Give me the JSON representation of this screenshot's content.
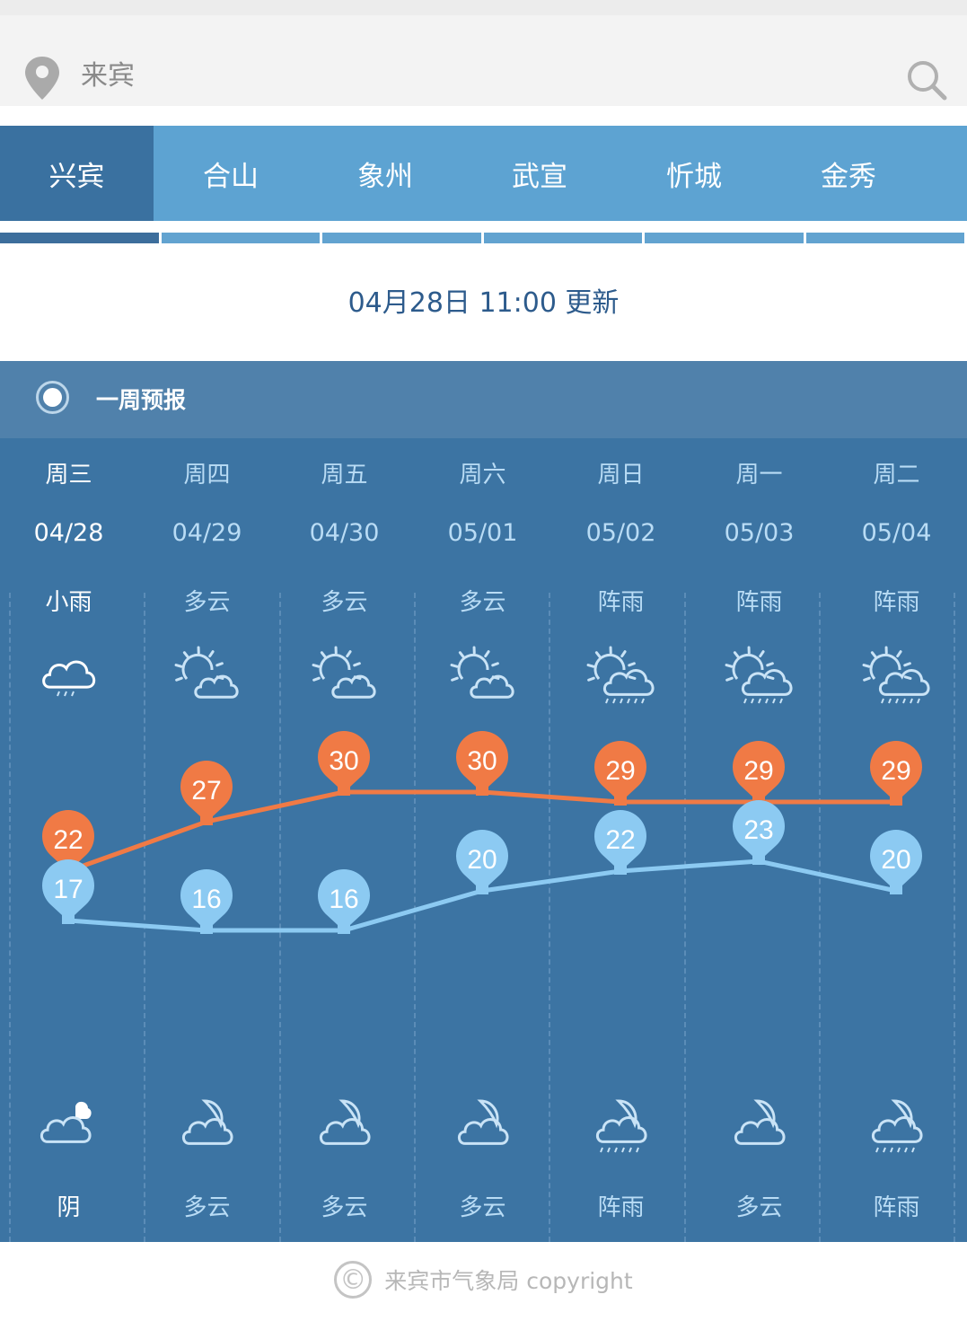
{
  "search": {
    "value": "来宾",
    "location_icon": "map-pin-icon",
    "search_icon": "search-icon"
  },
  "tabs": [
    {
      "label": "兴宾",
      "active": true
    },
    {
      "label": "合山",
      "active": false
    },
    {
      "label": "象州",
      "active": false
    },
    {
      "label": "武宣",
      "active": false
    },
    {
      "label": "忻城",
      "active": false
    },
    {
      "label": "金秀",
      "active": false
    }
  ],
  "update_time": "04月28日 11:00 更新",
  "panel": {
    "title": "一周预报"
  },
  "days": [
    {
      "dow": "周三",
      "date": "04/28",
      "day_weather": "小雨",
      "day_icon": "light-rain",
      "night_weather": "阴",
      "night_icon": "overcast",
      "high": 22,
      "low": 17
    },
    {
      "dow": "周四",
      "date": "04/29",
      "day_weather": "多云",
      "day_icon": "partly-cloudy-day",
      "night_weather": "多云",
      "night_icon": "partly-cloudy-night",
      "high": 27,
      "low": 16
    },
    {
      "dow": "周五",
      "date": "04/30",
      "day_weather": "多云",
      "day_icon": "partly-cloudy-day",
      "night_weather": "多云",
      "night_icon": "partly-cloudy-night",
      "high": 30,
      "low": 16
    },
    {
      "dow": "周六",
      "date": "05/01",
      "day_weather": "多云",
      "day_icon": "partly-cloudy-day",
      "night_weather": "多云",
      "night_icon": "partly-cloudy-night",
      "high": 30,
      "low": 20
    },
    {
      "dow": "周日",
      "date": "05/02",
      "day_weather": "阵雨",
      "day_icon": "shower-day",
      "night_weather": "阵雨",
      "night_icon": "shower-night",
      "high": 29,
      "low": 22
    },
    {
      "dow": "周一",
      "date": "05/03",
      "day_weather": "阵雨",
      "day_icon": "shower-day",
      "night_weather": "多云",
      "night_icon": "partly-cloudy-night",
      "high": 29,
      "low": 23
    },
    {
      "dow": "周二",
      "date": "05/04",
      "day_weather": "阵雨",
      "day_icon": "shower-day",
      "night_weather": "阵雨",
      "night_icon": "shower-night",
      "high": 29,
      "low": 20
    }
  ],
  "chart_data": {
    "type": "line",
    "title": "",
    "categories": [
      "04/28",
      "04/29",
      "04/30",
      "05/01",
      "05/02",
      "05/03",
      "05/04"
    ],
    "series": [
      {
        "name": "high",
        "values": [
          22,
          27,
          30,
          30,
          29,
          29,
          29
        ],
        "color": "#f07a45"
      },
      {
        "name": "low",
        "values": [
          17,
          16,
          16,
          20,
          22,
          23,
          20
        ],
        "color": "#8ccaf2"
      }
    ],
    "xlabel": "",
    "ylabel": "",
    "grid": false
  },
  "footer": {
    "text": "来宾市气象局 copyright",
    "icon": "copyright-icon"
  },
  "colors": {
    "tab_bg": "#5da3d2",
    "tab_active": "#3a71a0",
    "panel_head": "#5081ab",
    "panel_body": "#3c74a3",
    "high": "#f07a45",
    "low": "#8ccaf2",
    "update_text": "#2d5b8c"
  }
}
